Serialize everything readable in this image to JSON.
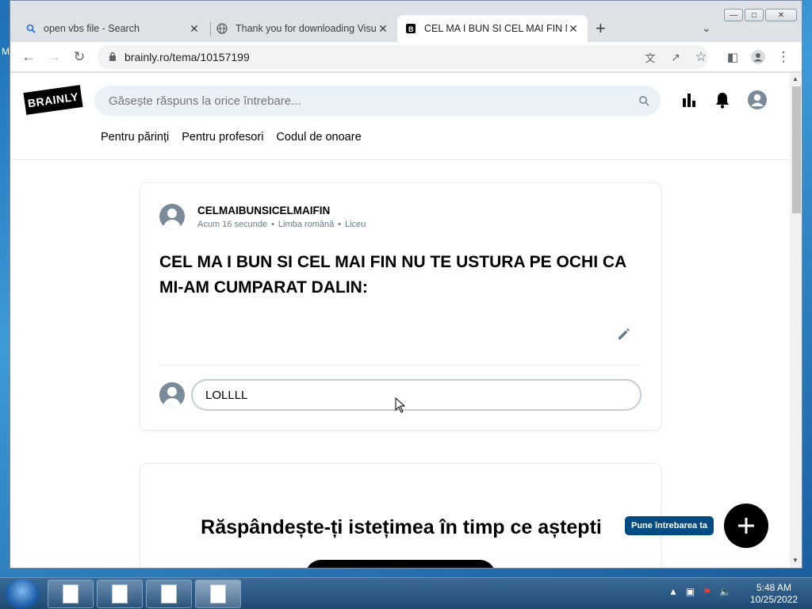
{
  "desktop": {
    "edge_label": "M"
  },
  "tabs": [
    {
      "title": "open vbs file - Search",
      "icon": "search-icon"
    },
    {
      "title": "Thank you for downloading Visual",
      "icon": "globe-icon"
    },
    {
      "title": "CEL MA I BUN SI CEL MAI FIN NU",
      "icon": "brainly-favicon-icon",
      "active": true
    }
  ],
  "toolbar": {
    "url": "brainly.ro/tema/10157199"
  },
  "header": {
    "logo": "BRAINLY",
    "search_placeholder": "Găsește răspuns la orice întrebare...",
    "nav": [
      "Pentru părinți",
      "Pentru profesori",
      "Codul de onoare"
    ]
  },
  "question": {
    "author": "CELMAIBUNSICELMAIFIN",
    "meta": [
      "Acum 16 secunde",
      "•",
      "Limba română",
      "•",
      "Liceu"
    ],
    "text": "CEL MA I BUN SI CEL MAI FIN NU TE USTURA PE OCHI CA MI-AM CUMPARAT DALIN:",
    "comment_value": "LOLLLL"
  },
  "promo": {
    "title": "Răspândește-ți istețimea în timp ce aștepti"
  },
  "ask": {
    "label": "Pune întrebarea ta"
  },
  "taskbar": {
    "time": "5:48 AM",
    "date": "10/25/2022"
  },
  "colors": {
    "accent": "#014a82",
    "search_bg": "#ebf2f7",
    "avatar": "#7a8a99"
  }
}
